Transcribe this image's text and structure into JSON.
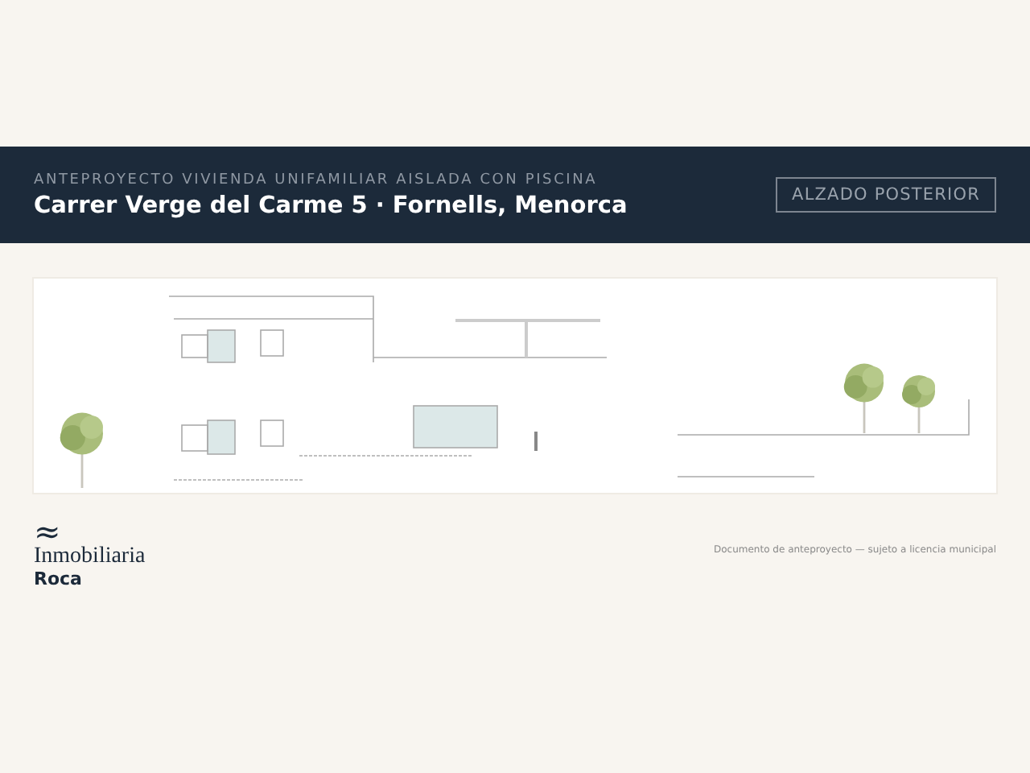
{
  "header": {
    "subtitle": "ANTEPROYECTO VIVIENDA UNIFAMILIAR AISLADA CON PISCINA",
    "title": "Carrer Verge del Carme 5 · Fornells, Menorca",
    "badge": "ALZADO POSTERIOR"
  },
  "footer": {
    "logo_mark": "≈",
    "logo_line_1": "Inmobiliaria",
    "logo_line_2": "Roca",
    "note": "Documento de anteproyecto — sujeto a licencia municipal"
  }
}
